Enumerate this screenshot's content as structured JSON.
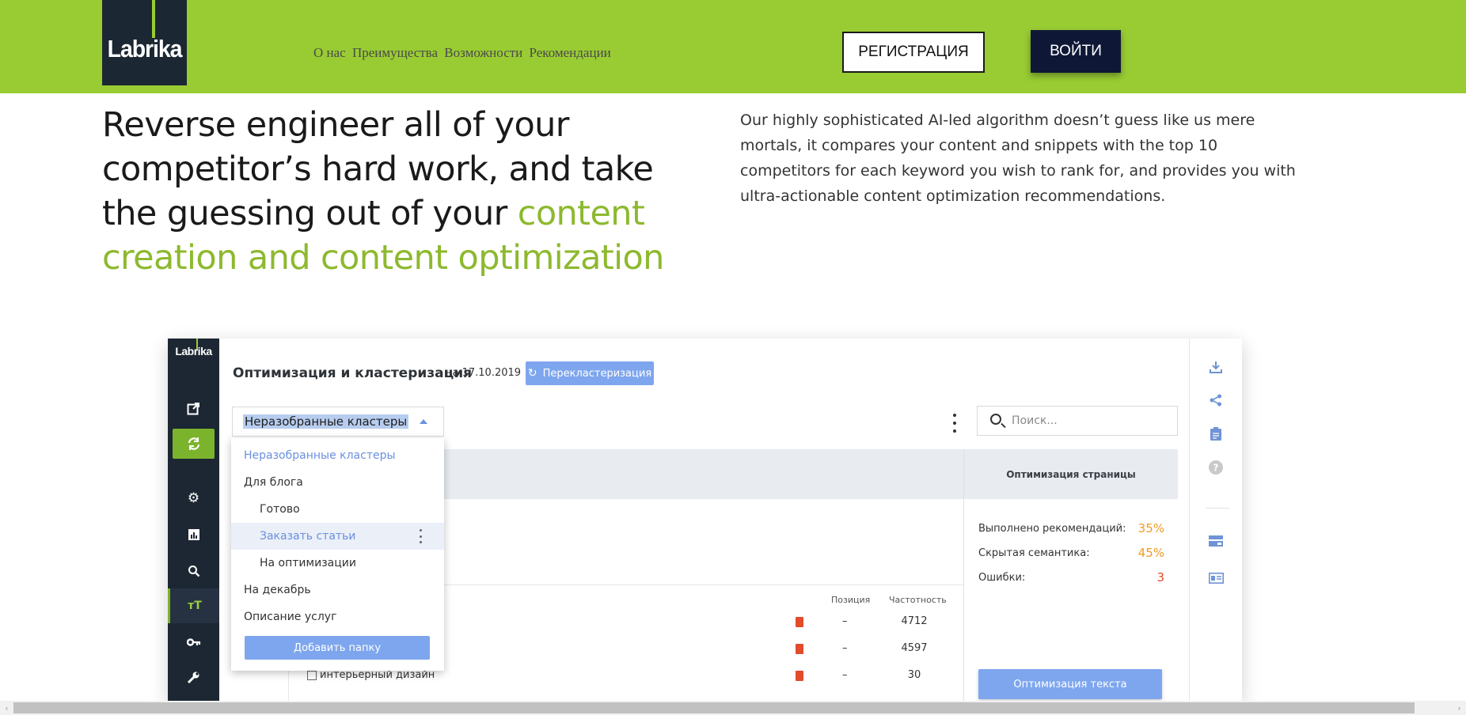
{
  "header": {
    "logo_text": "Labrika",
    "nav_items": [
      "О нас",
      "Преимущества",
      "Возможности",
      "Рекомендации"
    ],
    "register_label": "РЕГИСТРАЦИЯ",
    "login_label": "ВОЙТИ",
    "colors": {
      "background": "#99cc33",
      "logo_bg": "#1b2733",
      "login_bg": "#0e1836"
    }
  },
  "hero": {
    "title_plain": "Reverse engineer all of your competitor’s hard work, and take the guessing out of your",
    "title_accent": "content creation and content optimization",
    "description": "Our highly sophisticated AI-led algorithm doesn’t guess like us mere mortals, it compares your content and snippets with the top 10 competitors for each keyword you wish to rank for, and provides you with ultra-actionable content optimization recommendations.",
    "accent_color": "#8db92e"
  },
  "mock": {
    "logo_text": "Labrika",
    "sidebar_icons": [
      "external-link-icon",
      "refresh-icon",
      "gear-icon",
      "bar-chart-icon",
      "search-icon",
      "text-size-icon",
      "key-icon",
      "wrench-icon"
    ],
    "title": "Оптимизация и кластеризация",
    "date": "на 17.10.2019",
    "recluster_label": "Перекластеризация",
    "select_value": "Неразобранные кластеры",
    "search_placeholder": "Поиск...",
    "dropdown": {
      "items": [
        {
          "label": "Неразобранные кластеры",
          "indent": false,
          "state": "selected"
        },
        {
          "label": "Для блога",
          "indent": false,
          "state": "normal"
        },
        {
          "label": "Готово",
          "indent": true,
          "state": "normal"
        },
        {
          "label": "Заказать статьи",
          "indent": true,
          "state": "highlighted"
        },
        {
          "label": "На оптимизации",
          "indent": true,
          "state": "normal"
        },
        {
          "label": "На декабрь",
          "indent": false,
          "state": "normal"
        },
        {
          "label": "Описание услуг",
          "indent": false,
          "state": "normal"
        }
      ],
      "add_label": "Добавить папку"
    },
    "table": {
      "col_position": "Позиция",
      "col_frequency": "Частотность",
      "rows": [
        {
          "keyword": "",
          "position": "–",
          "frequency": "4712"
        },
        {
          "keyword": "",
          "position": "–",
          "frequency": "4597"
        },
        {
          "keyword": "интерьерный дизайн",
          "position": "–",
          "frequency": "30"
        }
      ]
    },
    "panel": {
      "heading": "Оптимизация страницы",
      "metrics": [
        {
          "label": "Выполнено рекомендаций:",
          "value": "35%",
          "kind": "warn"
        },
        {
          "label": "Скрытая семантика:",
          "value": "45%",
          "kind": "warn"
        },
        {
          "label": "Ошибки:",
          "value": "3",
          "kind": "error"
        }
      ],
      "button_label": "Оптимизация текста"
    },
    "toolbar_icons": [
      "download-icon",
      "share-icon",
      "clipboard-icon",
      "help-icon",
      "layout-icon",
      "id-card-icon"
    ],
    "colors": {
      "accent": "#7ea6ee",
      "sidebar": "#1c2733",
      "green": "#7cb32c",
      "warn": "#ef9b22",
      "error": "#e04a2a"
    }
  },
  "scrollbar": {
    "left_arrow": "‹",
    "right_arrow": "›"
  }
}
